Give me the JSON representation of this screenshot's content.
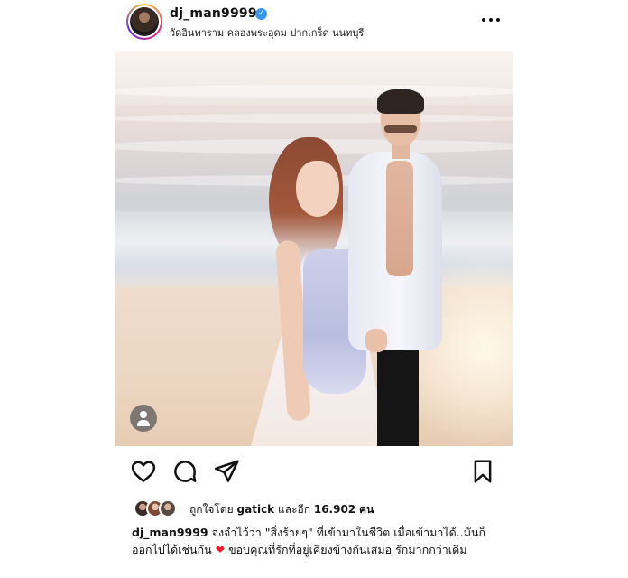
{
  "header": {
    "username": "dj_man9999",
    "location": "วัดอินทาราม คลองพระอุดม ปากเกร็ด นนทบุรี",
    "verified_icon": "verified-badge-icon"
  },
  "colors": {
    "verified": "#3897f0",
    "heart": "#ed1c24",
    "text": "#111111"
  },
  "actions": {
    "like_icon": "heart-outline-icon",
    "comment_icon": "comment-bubble-icon",
    "share_icon": "paper-plane-icon",
    "save_icon": "bookmark-icon"
  },
  "likes": {
    "prefix": "ถูกใจโดย",
    "user": "gatick",
    "middle": "และอีก",
    "count": "16.902",
    "suffix": "คน"
  },
  "caption": {
    "username": "dj_man9999",
    "text_part1": "จงจำไว้ว่า \"สิ่งร้ายๆ\" ที่เข้ามาในชีวิต เมื่อเข้ามาได้..มันก็ออกไปได้เช่นกัน",
    "emoji": "❤️",
    "text_part2": "ขอบคุณที่รักที่อยู่เคียงข้างกันเสมอ รักมากกว่าเดิม"
  }
}
